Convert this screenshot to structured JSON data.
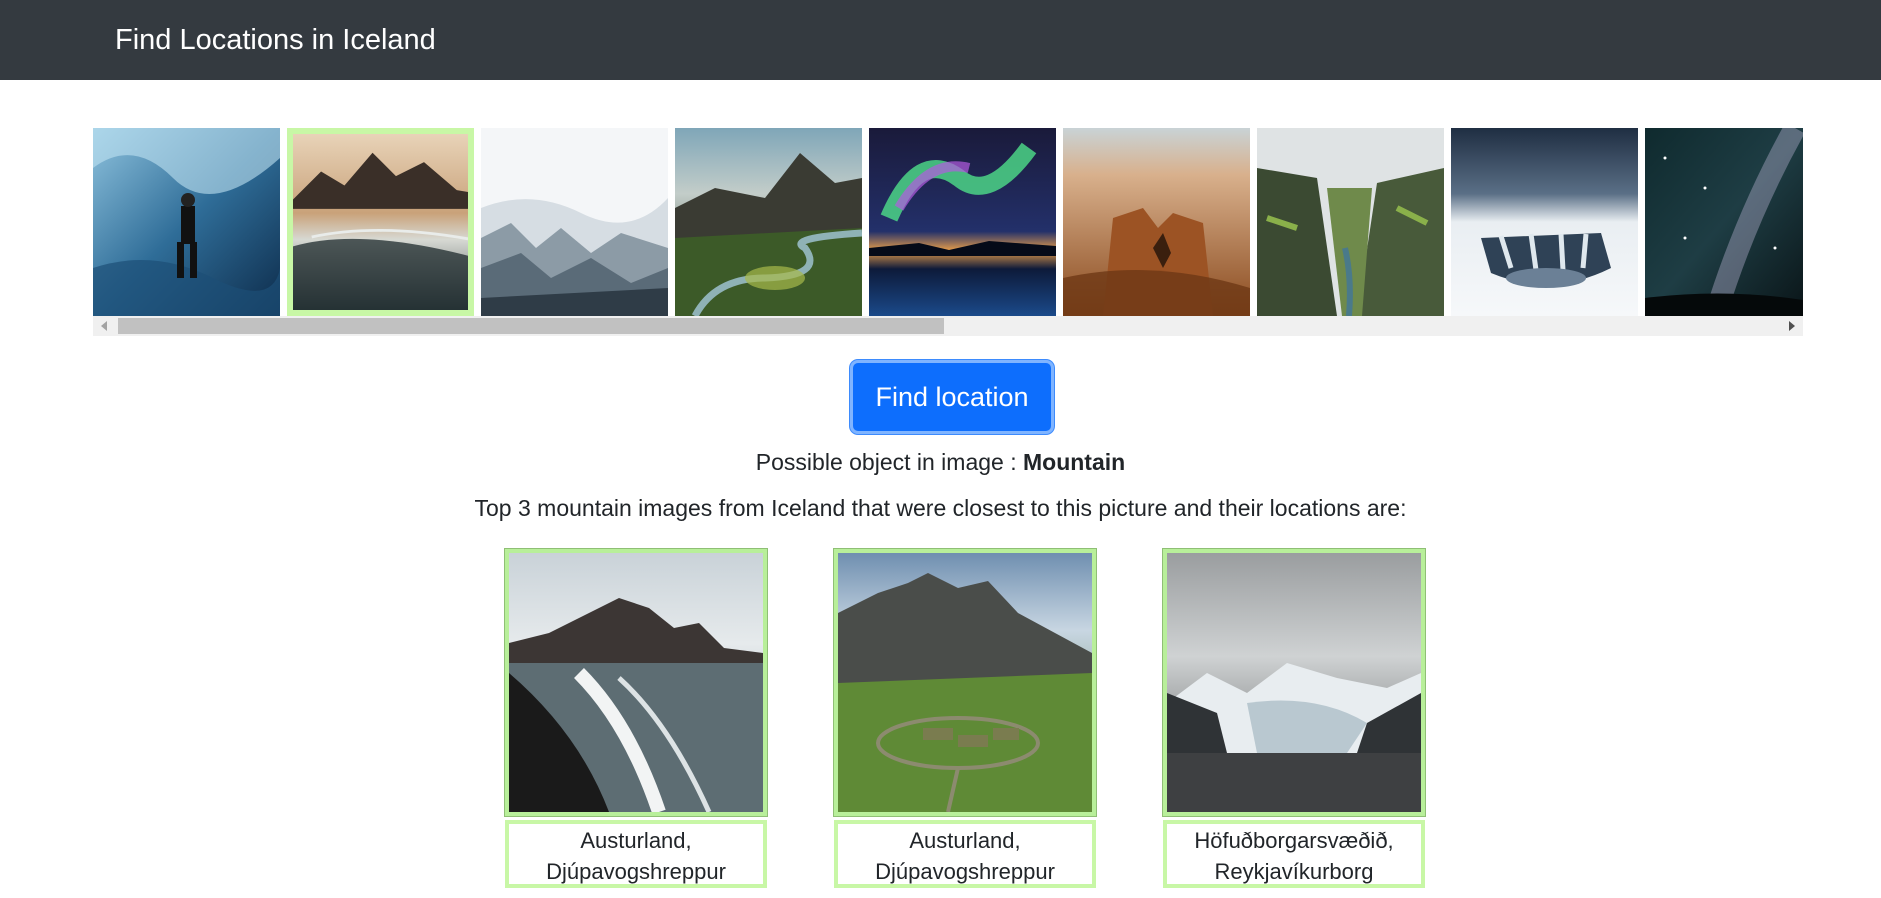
{
  "navbar": {
    "title": "Find Locations in Iceland"
  },
  "gallery": {
    "thumbnails": [
      {
        "name": "ice-cave-thumbnail"
      },
      {
        "name": "mountain-beach-thumbnail",
        "selected": true
      },
      {
        "name": "glacier-thumbnail"
      },
      {
        "name": "river-valley-thumbnail"
      },
      {
        "name": "aurora-thumbnail"
      },
      {
        "name": "canyon-rock-thumbnail"
      },
      {
        "name": "mossy-canyon-thumbnail"
      },
      {
        "name": "snowy-waterfall-thumbnail"
      },
      {
        "name": "milky-way-thumbnail"
      }
    ]
  },
  "action": {
    "find_label": "Find location"
  },
  "detection": {
    "prefix": "Possible object in image : ",
    "object": "Mountain"
  },
  "results": {
    "heading": "Top 3 mountain images from Iceland that were closest to this picture and their locations are:",
    "items": [
      {
        "line1": "Austurland,",
        "line2": "Djúpavogshreppur"
      },
      {
        "line1": "Austurland,",
        "line2": "Djúpavogshreppur"
      },
      {
        "line1": "Höfuðborgarsvæðið,",
        "line2": "Reykjavíkurborg"
      }
    ]
  },
  "colors": {
    "navbar": "#343a40",
    "button": "#0d6efd",
    "highlight": "#c8f7a6"
  }
}
